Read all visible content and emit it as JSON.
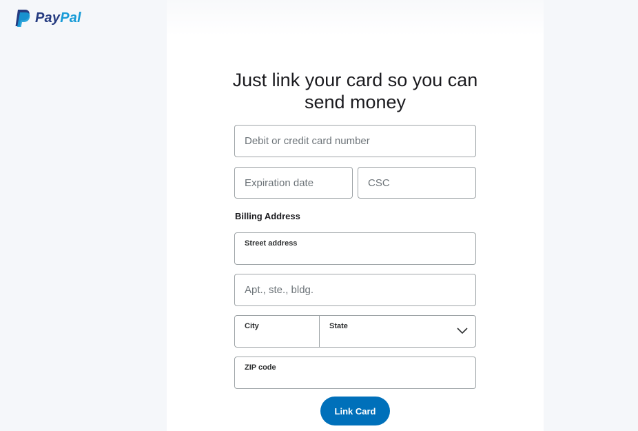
{
  "brand": {
    "name_part1": "Pay",
    "name_part2": "Pal"
  },
  "title_line1": "Just link your card so you can",
  "title_line2": "send money",
  "card_form": {
    "card_number_placeholder": "Debit or credit card number",
    "expiration_placeholder": "Expiration date",
    "csc_placeholder": "CSC"
  },
  "billing": {
    "section_label": "Billing Address",
    "street_label": "Street address",
    "street_value": "",
    "apt_placeholder": "Apt., ste., bldg.",
    "city_label": "City",
    "city_value": "",
    "state_label": "State",
    "state_value": "",
    "zip_label": "ZIP code",
    "zip_value": ""
  },
  "link_button_label": "Link Card",
  "colors": {
    "primary_button": "#0070ba",
    "brand_dark": "#253b80",
    "brand_light": "#179bd7"
  }
}
